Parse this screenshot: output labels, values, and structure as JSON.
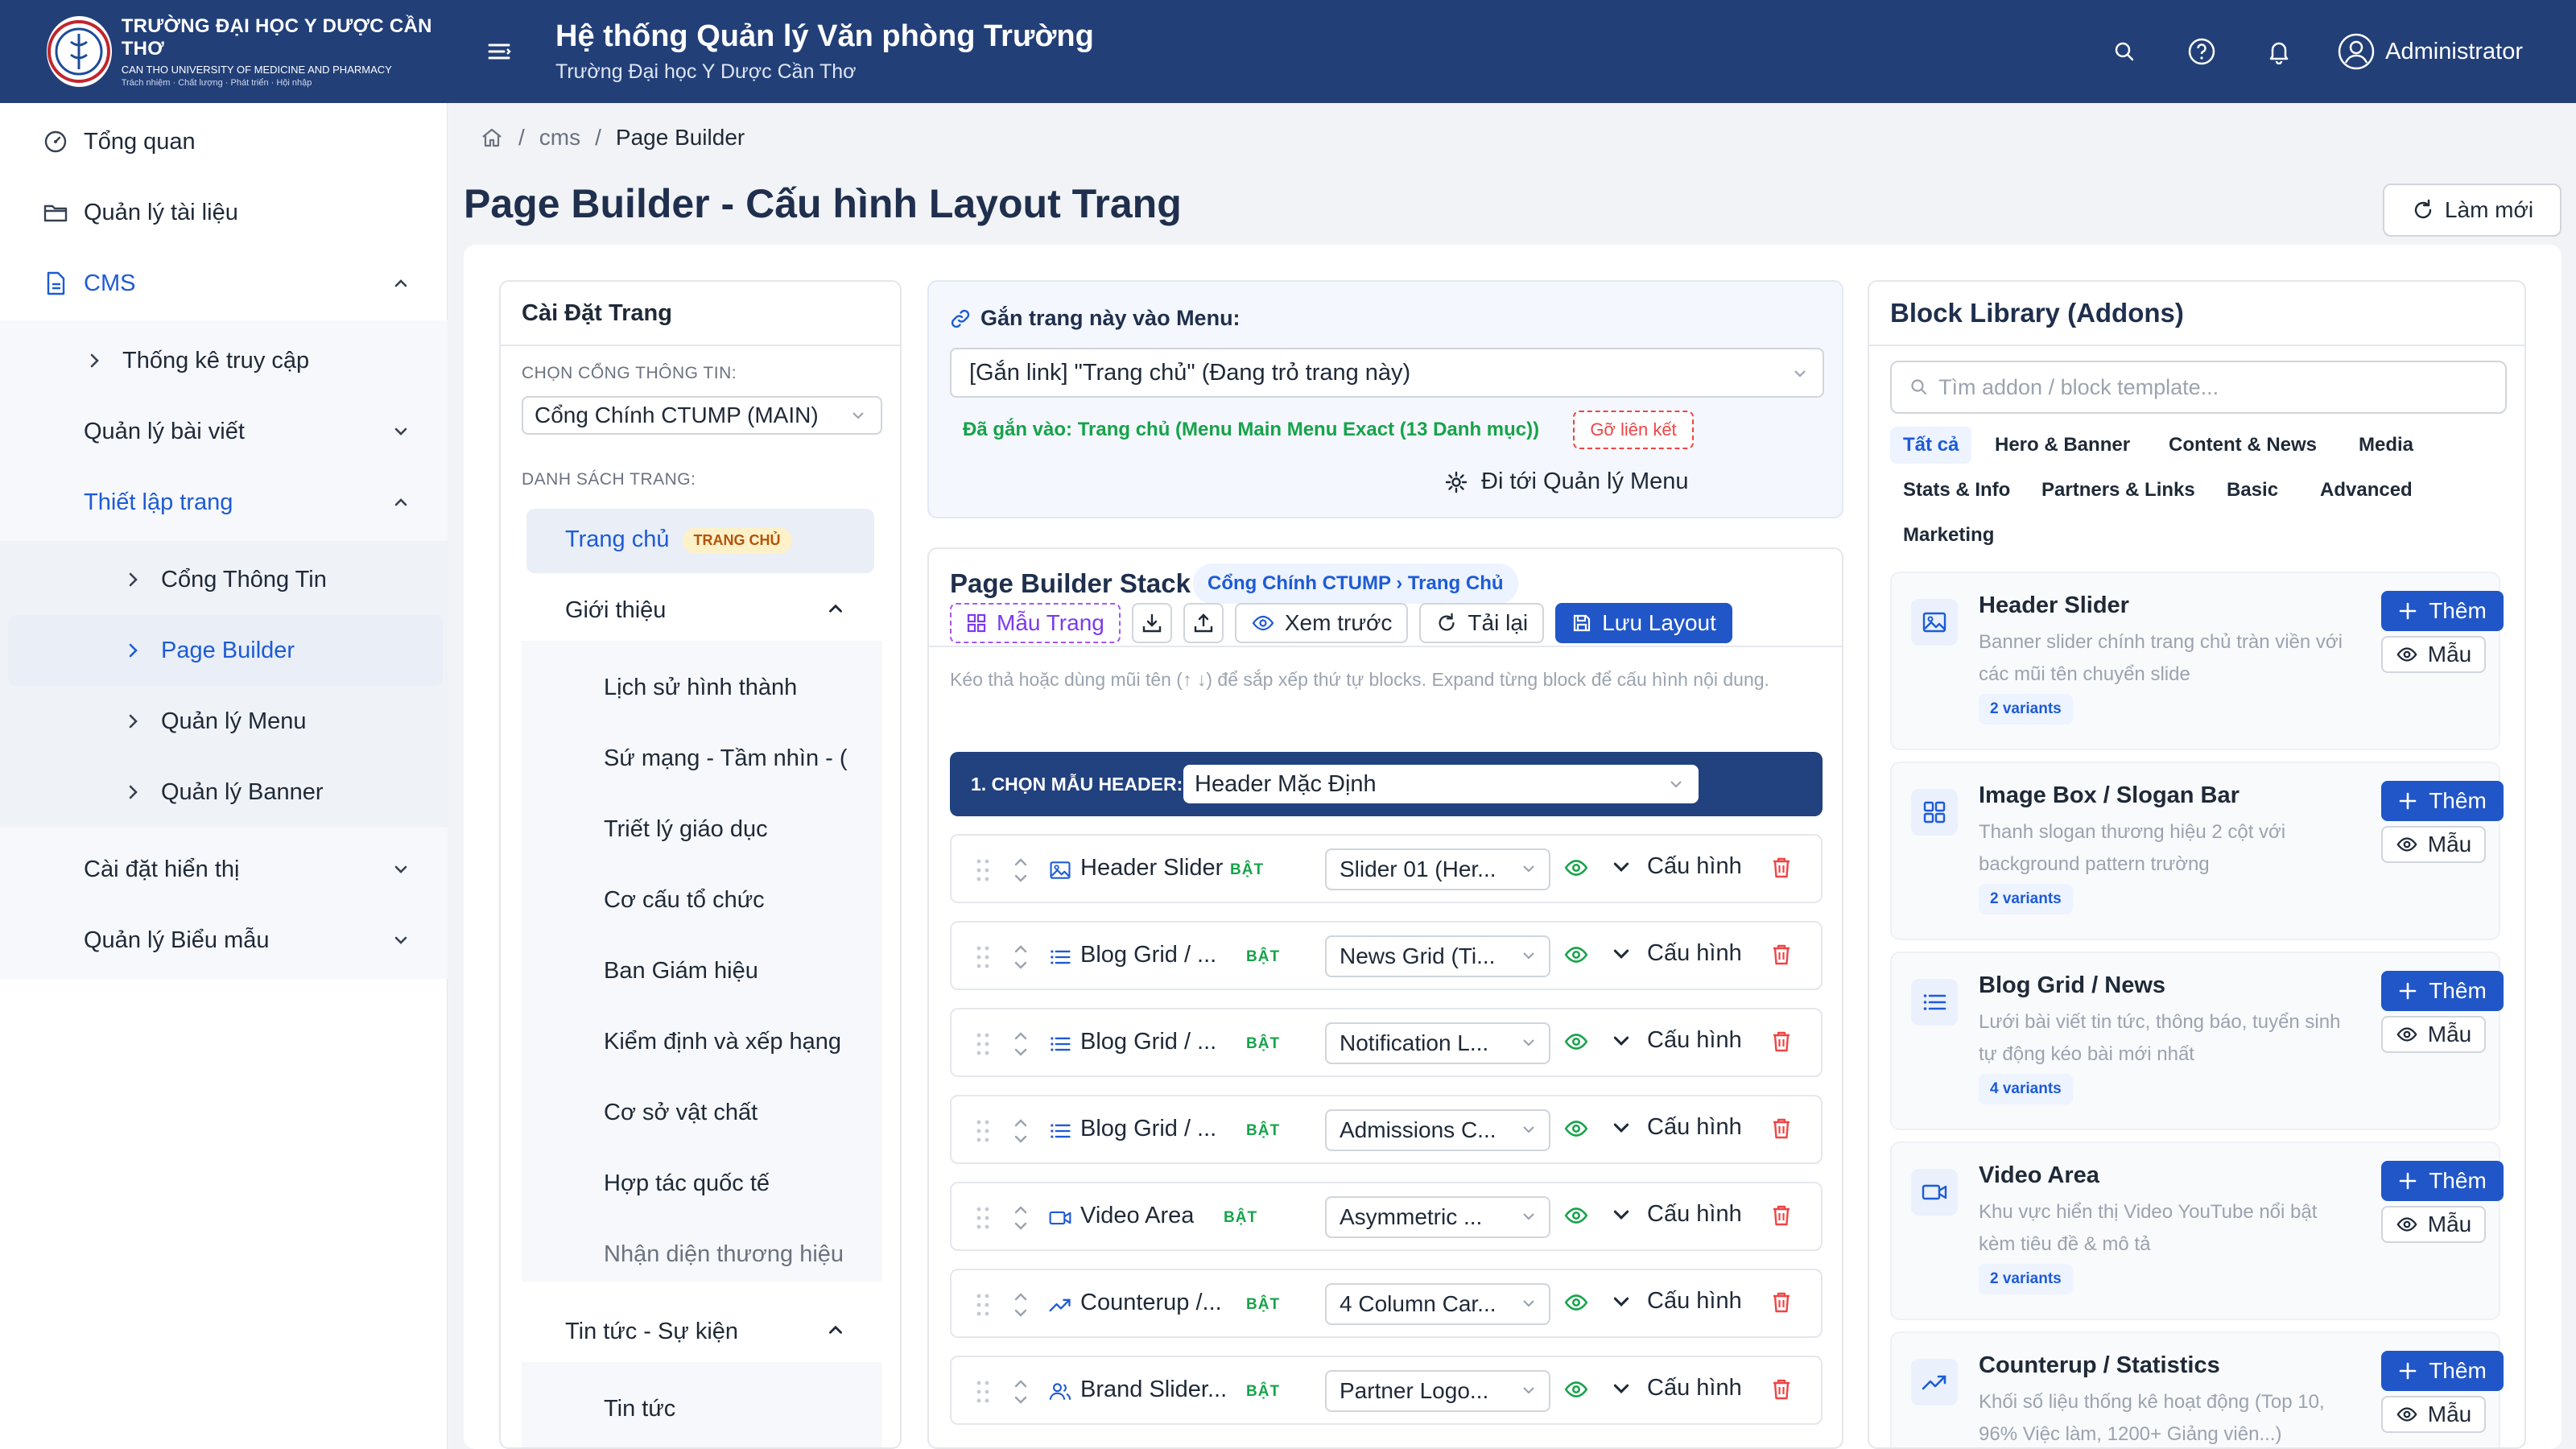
{
  "brand": {
    "university_vi": "TRƯỜNG ĐẠI HỌC Y DƯỢC CẦN THƠ",
    "university_en": "CAN THO UNIVERSITY OF MEDICINE AND PHARMACY",
    "motto": "Trách nhiệm · Chất lượng · Phát triển · Hội nhập"
  },
  "header": {
    "system_title": "Hệ thống Quản lý Văn phòng Trường",
    "system_subtitle": "Trường Đại học Y Dược Cần Thơ",
    "user_name": "Administrator"
  },
  "sidebar": {
    "overview": "Tổng quan",
    "documents": "Quản lý tài liệu",
    "cms": "CMS",
    "access_stats": "Thống kê truy cập",
    "posts": "Quản lý bài viết",
    "page_setup": "Thiết lập trang",
    "portal": "Cổng Thông Tin",
    "page_builder": "Page Builder",
    "menu_manage": "Quản lý Menu",
    "banner_manage": "Quản lý Banner",
    "display_settings": "Cài đặt hiển thị",
    "forms": "Quản lý Biểu mẫu"
  },
  "breadcrumb": {
    "level1": "cms",
    "level2": "Page Builder"
  },
  "page": {
    "title": "Page Builder - Cấu hình Layout Trang",
    "refresh_label": "Làm mới"
  },
  "settings": {
    "title": "Cài Đặt Trang",
    "portal_label": "CHỌN CỔNG THÔNG TIN:",
    "portal_value": "Cổng Chính CTUMP (MAIN)",
    "pages_label": "DANH SÁCH TRANG:",
    "pages": {
      "home": "Trang chủ",
      "home_badge": "TRANG CHỦ",
      "intro": "Giới thiệu",
      "intro_children": [
        "Lịch sử hình thành",
        "Sứ mạng - Tầm nhìn - (",
        "Triết lý giáo dục",
        "Cơ cấu tổ chức",
        "Ban Giám hiệu",
        "Kiểm định và xếp hạng",
        "Cơ sở vật chất",
        "Hợp tác quốc tế",
        "Nhận diện thương hiệu"
      ],
      "news_group": "Tin tức - Sự kiện",
      "news_children": [
        "Tin tức"
      ]
    }
  },
  "menu_link": {
    "title": "Gắn trang này vào Menu:",
    "select_value": "[Gắn link] \"Trang chủ\" (Đang trỏ trang này)",
    "linked_status": "Đã gắn vào: Trang chủ (Menu Main Menu Exact (13 Danh mục))",
    "unlink": "Gỡ liên kết",
    "goto": "Đi tới Quản lý Menu"
  },
  "stack": {
    "title": "Page Builder Stack",
    "breadcrumb_tag": "Cổng Chính CTUMP › Trang Chủ",
    "toolbar": {
      "templates": "Mẫu Trang",
      "preview": "Xem trước",
      "reload": "Tải lại",
      "save": "Lưu Layout"
    },
    "help": "Kéo thả hoặc dùng mũi tên (↑ ↓) để sắp xếp thứ tự blocks. Expand từng block để cấu hình nội dung.",
    "header_label": "1. CHỌN MẪU HEADER:",
    "header_value": "Header Mặc Định",
    "on_label": "BẬT",
    "config_label": "Cấu hình",
    "blocks": [
      {
        "name": "Header Slider",
        "icon": "image-icon",
        "variant": "Slider 01 (Her..."
      },
      {
        "name": "Blog Grid / ...",
        "icon": "list-icon",
        "variant": "News Grid (Ti..."
      },
      {
        "name": "Blog Grid / ...",
        "icon": "list-icon",
        "variant": "Notification L..."
      },
      {
        "name": "Blog Grid / ...",
        "icon": "list-icon",
        "variant": "Admissions C..."
      },
      {
        "name": "Video Area",
        "icon": "video-icon",
        "variant": "Asymmetric ..."
      },
      {
        "name": "Counterup /...",
        "icon": "trend-icon",
        "variant": "4 Column Car..."
      },
      {
        "name": "Brand Slider...",
        "icon": "users-icon",
        "variant": "Partner Logo..."
      }
    ]
  },
  "library": {
    "title": "Block Library (Addons)",
    "search_placeholder": "Tìm addon / block template...",
    "filters": [
      "Tất cả",
      "Hero & Banner",
      "Content & News",
      "Media",
      "Stats & Info",
      "Partners & Links",
      "Basic",
      "Advanced",
      "Marketing"
    ],
    "add_label": "Thêm",
    "preview_label": "Mẫu",
    "addons": [
      {
        "name": "Header Slider",
        "desc": "Banner slider chính trang chủ tràn viền với các mũi tên chuyển slide",
        "variants": "2 variants",
        "icon": "image-icon"
      },
      {
        "name": "Image Box / Slogan Bar",
        "desc": "Thanh slogan thương hiệu 2 cột với background pattern trường",
        "variants": "2 variants",
        "icon": "grid-icon"
      },
      {
        "name": "Blog Grid / News",
        "desc": "Lưới bài viết tin tức, thông báo, tuyển sinh tự động kéo bài mới nhất",
        "variants": "4 variants",
        "icon": "list-icon"
      },
      {
        "name": "Video Area",
        "desc": "Khu vực hiển thị Video YouTube nổi bật kèm tiêu đề & mô tả",
        "variants": "2 variants",
        "icon": "video-icon"
      },
      {
        "name": "Counterup / Statistics",
        "desc": "Khối số liệu thống kê hoạt động (Top 10, 96% Việc làm, 1200+ Giảng viên...)",
        "variants": "",
        "icon": "trend-icon"
      }
    ]
  },
  "colors": {
    "primary": "#223f78",
    "accent": "#2156c8",
    "success": "#16a34a",
    "danger": "#ef4444"
  }
}
